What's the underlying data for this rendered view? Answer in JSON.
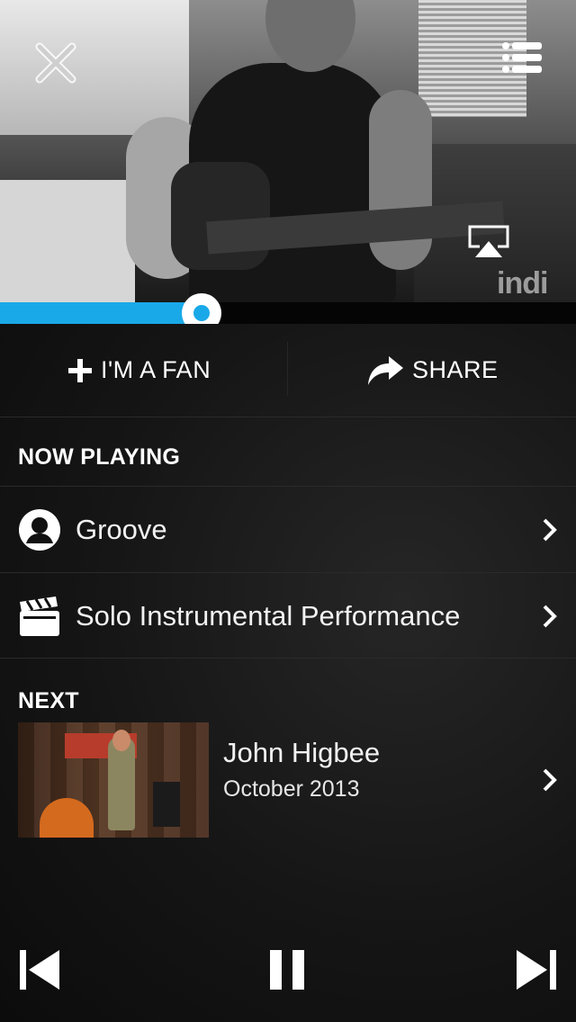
{
  "player": {
    "progress_fraction": 0.35,
    "accent_color": "#1aa9e8",
    "watermark": "indi",
    "top_left_icon": "close-icon",
    "top_right_icon": "list-icon",
    "airplay_icon": "airplay-icon"
  },
  "actions": {
    "fan_label": "I'M A FAN",
    "fan_icon": "plus-icon",
    "share_label": "SHARE",
    "share_icon": "share-arrow-icon"
  },
  "now_playing": {
    "title": "NOW PLAYING",
    "items": [
      {
        "label": "Groove",
        "icon": "user-icon"
      },
      {
        "label": "Solo Instrumental Performance",
        "icon": "clapperboard-icon"
      }
    ]
  },
  "next": {
    "title": "NEXT",
    "item": {
      "title": "John Higbee",
      "date": "October 2013"
    }
  },
  "controls": {
    "previous_icon": "skip-previous-icon",
    "pause_icon": "pause-icon",
    "next_icon": "skip-next-icon"
  }
}
